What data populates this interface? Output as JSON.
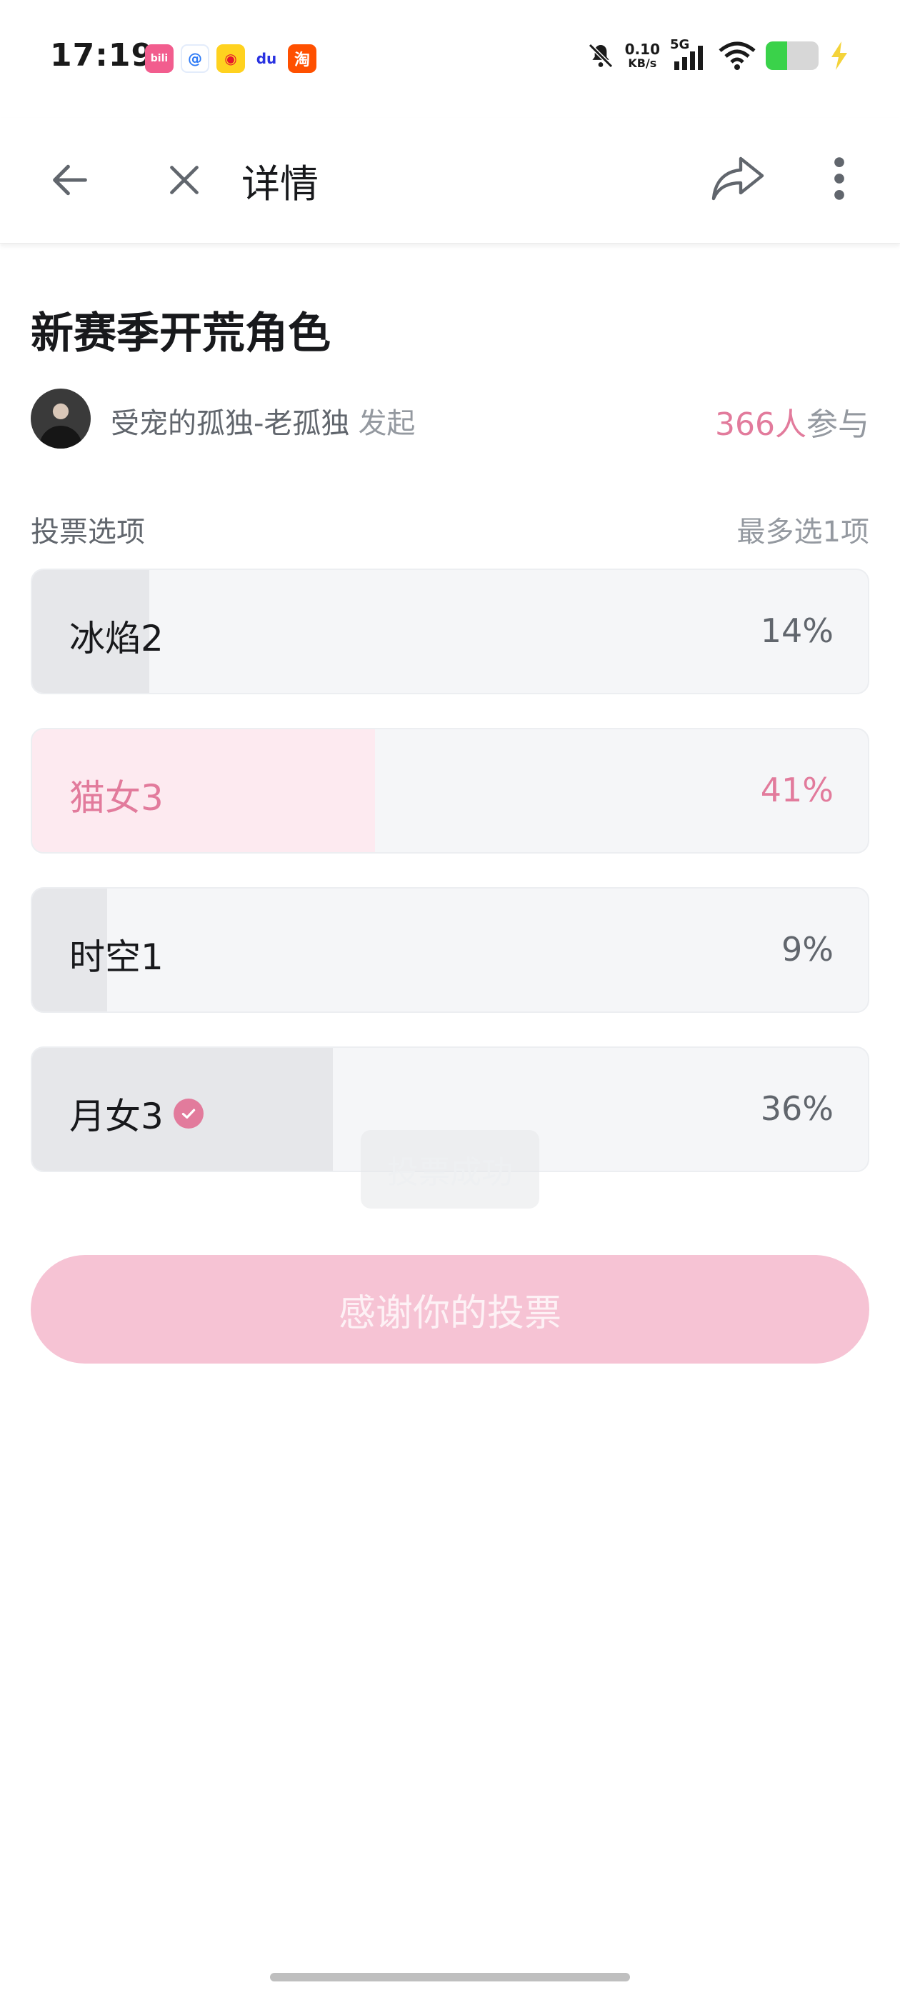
{
  "status_bar": {
    "time": "17:19",
    "app_icons": [
      {
        "name": "bilibili-icon",
        "glyph": "bili",
        "color": "#f25d8e"
      },
      {
        "name": "qq-browser-icon",
        "glyph": "@",
        "color": "#2f7bf6"
      },
      {
        "name": "weibo-icon",
        "glyph": "◉",
        "color": "#e6162d"
      },
      {
        "name": "baidu-icon",
        "glyph": "du",
        "color": "#2932e1"
      },
      {
        "name": "taobao-icon",
        "glyph": "淘",
        "color": "#ff5000"
      }
    ],
    "net_speed_value": "0.10",
    "net_speed_unit": "KB/s",
    "network_type": "5G",
    "battery_color": "#3ad24a"
  },
  "header": {
    "title": "详情"
  },
  "poll": {
    "title": "新赛季开荒角色",
    "author_name": "受宠的孤独-老孤独",
    "author_suffix": "发起",
    "participant_count": "366人",
    "participant_suffix": "参与",
    "options_label": "投票选项",
    "limit_label": "最多选1项",
    "options": [
      {
        "label": "冰焰2",
        "percent_text": "14%",
        "percent": 14,
        "highlight": false,
        "checked": false
      },
      {
        "label": "猫女3",
        "percent_text": "41%",
        "percent": 41,
        "highlight": true,
        "checked": false
      },
      {
        "label": "时空1",
        "percent_text": "9%",
        "percent": 9,
        "highlight": false,
        "checked": false
      },
      {
        "label": "月女3",
        "percent_text": "36%",
        "percent": 36,
        "highlight": false,
        "checked": true
      }
    ],
    "toast": "投票成功",
    "vote_button": "感谢你的投票"
  },
  "colors": {
    "accent_pink": "#e27b9c",
    "button_pink": "#f6c3d4",
    "bar_fill": "#e6e7ea",
    "bar_fill_pink": "#fdeaf0"
  }
}
